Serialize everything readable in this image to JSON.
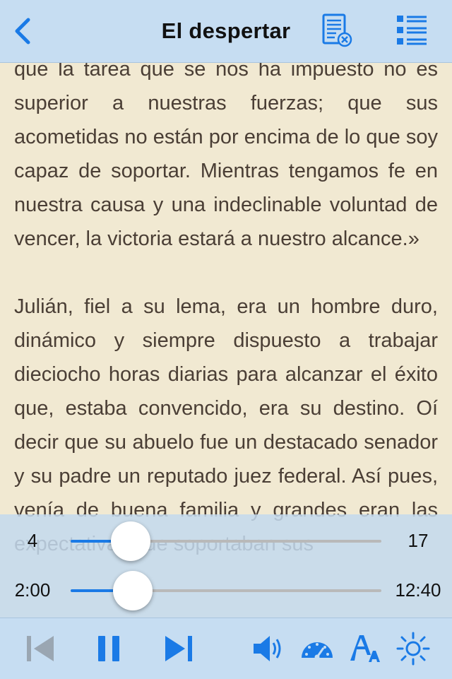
{
  "header": {
    "title": "El despertar"
  },
  "text": {
    "p1": "que la tarea que se nos ha impuesto no es superior a nuestras fuerzas; que sus acometidas no están por encima de lo que soy capaz de soportar. Mientras tengamos fe en nuestra causa y una indeclinable voluntad de vencer, la victoria estará a nuestro alcance.»",
    "p2": "Julián, fiel a su lema, era un hombre duro, dinámico y siempre dispuesto a trabajar dieciocho horas diarias para alcanzar el éxito que, estaba convencido, era su destino. Oí decir que su abuelo fue un destacado senador y su padre un reputado juez federal. Así pues, venía de buena familia y grandes eran las expectativas que soportaban sus"
  },
  "sliders": {
    "chapter": {
      "min_label": "4",
      "max_label": "17",
      "min": 4,
      "max": 17,
      "value": 6.5
    },
    "time": {
      "min_label": "2:00",
      "max_label": "12:40",
      "fraction": 0.2
    }
  },
  "icons": {
    "back": "chevron-left-icon",
    "notes": "notes-edit-icon",
    "toc": "list-icon",
    "prev": "skip-back-icon",
    "pause": "pause-icon",
    "next": "skip-forward-icon",
    "volume": "speaker-icon",
    "speed": "speedometer-icon",
    "font": "font-size-icon",
    "brightness": "brightness-icon"
  },
  "colors": {
    "accent": "#1a7ae6",
    "bar": "#c6ddf2",
    "page": "#f1e9d2",
    "text": "#4a3e35",
    "disabled": "#9aa6b2"
  }
}
